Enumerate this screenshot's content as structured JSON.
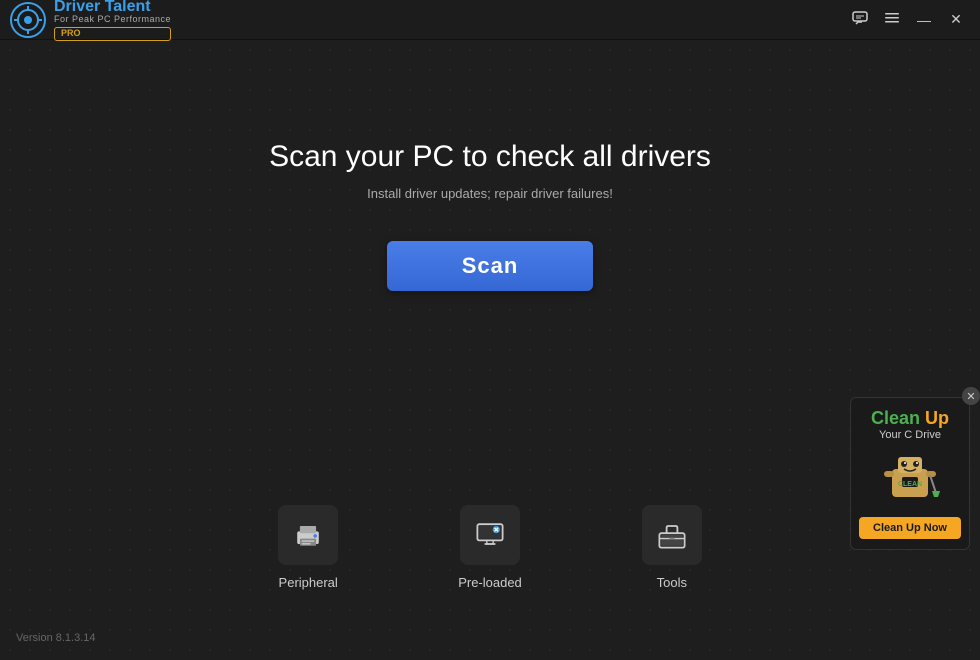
{
  "app": {
    "title": "Driver Talent",
    "subtitle": "For Peak PC Performance",
    "pro_badge": "PRO",
    "version": "Version 8.1.3.14"
  },
  "titlebar": {
    "chat_icon": "💬",
    "menu_icon": "☰",
    "minimize_icon": "—",
    "close_icon": "✕"
  },
  "main": {
    "heading": "Scan your PC to check all drivers",
    "subheading": "Install driver updates; repair driver failures!",
    "scan_button_label": "Scan"
  },
  "bottom_icons": [
    {
      "label": "Peripheral",
      "icon": "peripheral"
    },
    {
      "label": "Pre-loaded",
      "icon": "preloaded"
    },
    {
      "label": "Tools",
      "icon": "tools"
    }
  ],
  "cleanup_ad": {
    "line1_part1": "Clean",
    "line1_part2": "Up",
    "line2": "Your C Drive",
    "btn_label": "Clean Up Now"
  }
}
